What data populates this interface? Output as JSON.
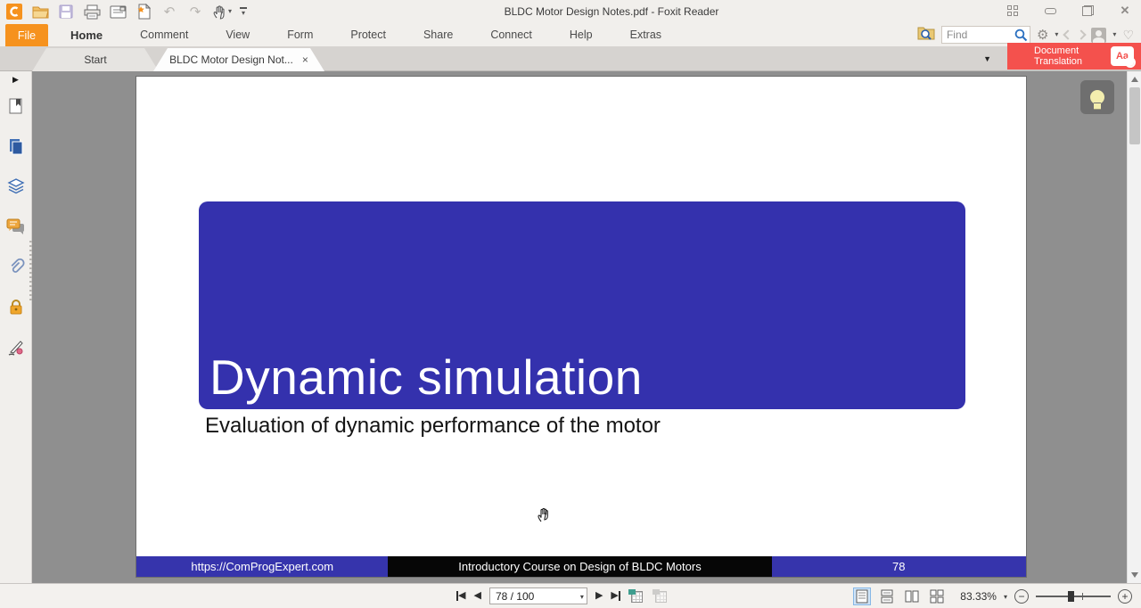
{
  "window": {
    "title": "BLDC Motor Design Notes.pdf - Foxit Reader"
  },
  "menu": {
    "items": [
      {
        "label": "File"
      },
      {
        "label": "Home"
      },
      {
        "label": "Comment"
      },
      {
        "label": "View"
      },
      {
        "label": "Form"
      },
      {
        "label": "Protect"
      },
      {
        "label": "Share"
      },
      {
        "label": "Connect"
      },
      {
        "label": "Help"
      },
      {
        "label": "Extras"
      }
    ]
  },
  "find": {
    "placeholder": "Find"
  },
  "translation": {
    "title": "Document\nTranslation",
    "icon_text": "Aa"
  },
  "tabbar": {
    "tabs": [
      {
        "label": "Start"
      },
      {
        "label": "BLDC Motor Design Not..."
      }
    ]
  },
  "slide": {
    "title": "Dynamic simulation",
    "subtitle": "Evaluation of dynamic performance of the motor",
    "footer": {
      "left": "https://ComProgExpert.com",
      "center": "Introductory Course on Design of BLDC Motors",
      "page": "78"
    }
  },
  "statusbar": {
    "page_value": "78 / 100",
    "zoom_value": "83.33%"
  },
  "icons": {
    "undo": "↶",
    "redo": "↷",
    "caret_down": "▾",
    "caret_down_big": "▼",
    "close_tab": "×",
    "close_window": "✕",
    "heart": "♡",
    "gear": "⚙",
    "tri_left": "◀",
    "tri_right": "▶",
    "minus": "−",
    "plus": "+",
    "expand_panel": "▶"
  },
  "colors": {
    "accent_blue": "#3431AD",
    "brand_orange": "#F6921E",
    "badge_red": "#F4514D",
    "footer_black": "#060606"
  }
}
